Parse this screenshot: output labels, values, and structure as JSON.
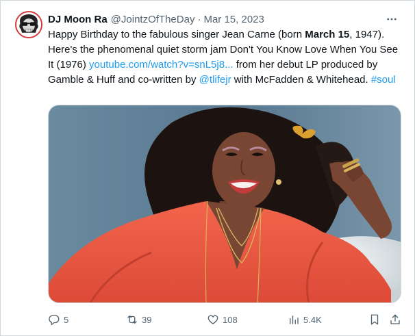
{
  "tweet": {
    "author": {
      "display_name": "DJ Moon Ra",
      "handle": "@JointzOfTheDay",
      "avatar_icon": "skull-with-sunglasses-avatar"
    },
    "separator": "·",
    "date": "Mar 15, 2023",
    "more_icon": "more-dots-icon",
    "text": {
      "p1": "Happy Birthday to the fabulous singer Jean Carne (born ",
      "bold_date": "March 15",
      "p2": ", 1947). Here's the phenomenal quiet storm jam Don't You Know Love When You See It (1976) ",
      "link": "youtube.com/watch?v=snL5j8...",
      "p3": " from her debut LP produced by Gamble & Huff and co-written by ",
      "mention": "@tlifejr",
      "p4": " with McFadden & Whitehead. ",
      "hashtag": "#soul"
    },
    "media": {
      "description_icon": "photo-woman-red-blouse",
      "colors": {
        "background": "#5f7d94",
        "blouse": "#ef5a44",
        "hair": "#1c1310",
        "skin": "#7a4634",
        "pillow": "#eceeef"
      }
    },
    "actions": {
      "replies": "5",
      "reposts": "39",
      "likes": "108",
      "views": "5.4K"
    },
    "colors": {
      "accent": "#1d9bf0",
      "muted": "#536471",
      "text": "#0f1419",
      "border": "#cfd9de"
    }
  }
}
